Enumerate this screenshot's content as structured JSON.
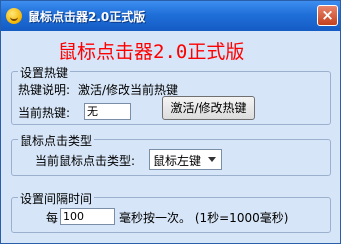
{
  "window": {
    "title": "鼠标点击器2.0正式版",
    "close_glyph": "×"
  },
  "heading": "鼠标点击器2.0正式版",
  "hotkey_group": {
    "title": "设置热键",
    "description_label": "热键说明:",
    "description_value": "激活/修改当前热键",
    "current_label": "当前热键:",
    "current_value": "无",
    "button_label": "激活/修改热键"
  },
  "click_type_group": {
    "title": "鼠标点击类型",
    "label": "当前鼠标点击类型:",
    "selected": "鼠标左键"
  },
  "interval_group": {
    "title": "设置间隔时间",
    "prefix": "每",
    "value": "100",
    "suffix": "毫秒按一次。 (1秒=1000毫秒)"
  }
}
